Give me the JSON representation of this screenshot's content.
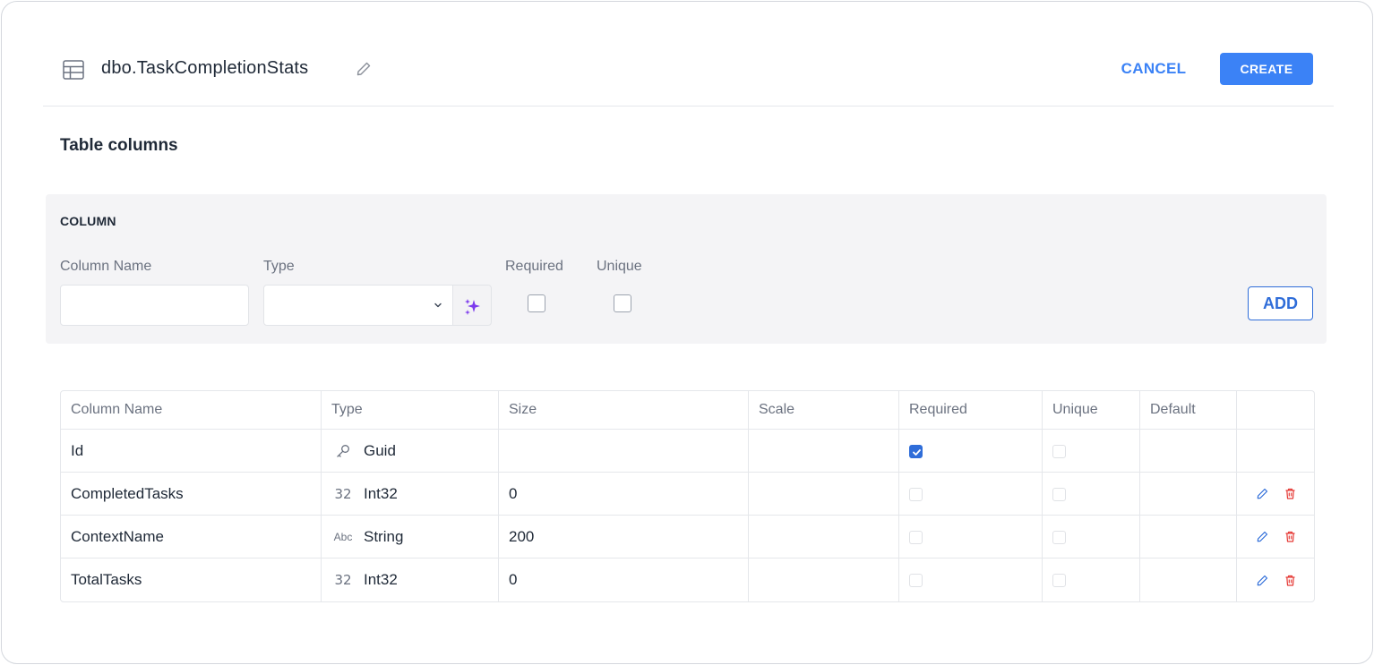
{
  "header": {
    "title": "dbo.TaskCompletionStats",
    "cancel_label": "CANCEL",
    "create_label": "CREATE",
    "accent_color": "#3b82f6"
  },
  "section_title": "Table columns",
  "add_panel": {
    "heading": "COLUMN",
    "labels": {
      "column_name": "Column Name",
      "type": "Type",
      "required": "Required",
      "unique": "Unique"
    },
    "column_name_value": "",
    "type_value": "",
    "required_checked": false,
    "unique_checked": false,
    "add_label": "ADD"
  },
  "table": {
    "headers": [
      "Column Name",
      "Type",
      "Size",
      "Scale",
      "Required",
      "Unique",
      "Default",
      ""
    ],
    "rows": [
      {
        "name": "Id",
        "type": "Guid",
        "type_icon": "key-icon",
        "size": "",
        "scale": "",
        "required": true,
        "unique": false,
        "default": "",
        "editable": false
      },
      {
        "name": "CompletedTasks",
        "type": "Int32",
        "type_icon": "number-icon",
        "type_glyph": "32",
        "size": "0",
        "scale": "",
        "required": false,
        "unique": false,
        "default": "",
        "editable": true
      },
      {
        "name": "ContextName",
        "type": "String",
        "type_icon": "text-icon",
        "type_glyph": "Abc",
        "size": "200",
        "scale": "",
        "required": false,
        "unique": false,
        "default": "",
        "editable": true
      },
      {
        "name": "TotalTasks",
        "type": "Int32",
        "type_icon": "number-icon",
        "type_glyph": "32",
        "size": "0",
        "scale": "",
        "required": false,
        "unique": false,
        "default": "",
        "editable": true
      }
    ]
  }
}
